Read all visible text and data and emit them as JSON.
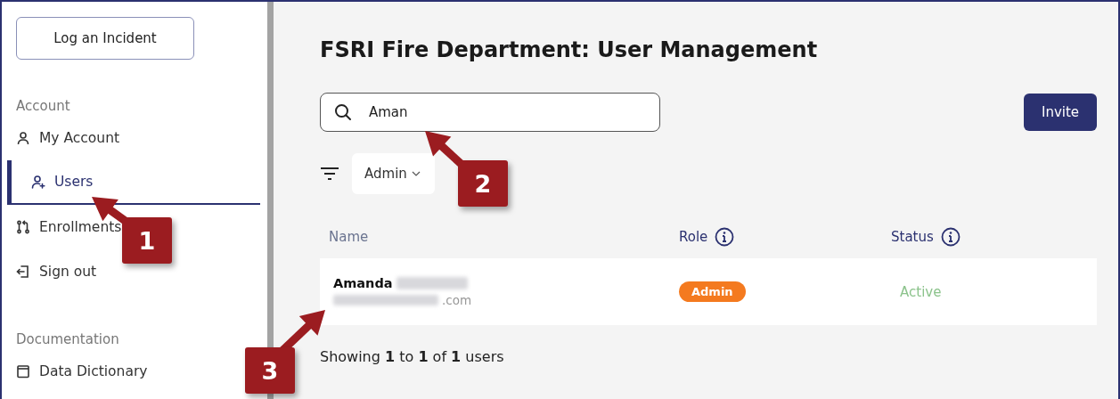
{
  "sidebar": {
    "action_button": "Log an Incident",
    "sections": [
      {
        "title": "Account",
        "items": [
          {
            "kind": "user",
            "label": "My Account",
            "selected": false
          },
          {
            "kind": "user-plus",
            "label": "Users",
            "selected": true
          },
          {
            "kind": "branch",
            "label": "Enrollments",
            "selected": false
          },
          {
            "kind": "sign-out",
            "label": "Sign out",
            "selected": false
          }
        ]
      },
      {
        "title": "Documentation",
        "items": [
          {
            "kind": "book",
            "label": "Data Dictionary",
            "selected": false
          }
        ]
      }
    ]
  },
  "main": {
    "title": "FSRI Fire Department: User Management",
    "search": {
      "value": "Aman"
    },
    "invite_button": "Invite",
    "role_filter": "Admin",
    "table": {
      "columns": [
        {
          "label": "Name",
          "info": false
        },
        {
          "label": "Role",
          "info": true
        },
        {
          "label": "Status",
          "info": true
        }
      ],
      "rows": [
        {
          "first_name": "Amanda",
          "email_suffix": ".com",
          "role": "Admin",
          "status": "Active"
        }
      ]
    },
    "footer": "Showing **1** to **1** of **1** users"
  },
  "callouts": [
    {
      "number": "1"
    },
    {
      "number": "2"
    },
    {
      "number": "3"
    }
  ]
}
